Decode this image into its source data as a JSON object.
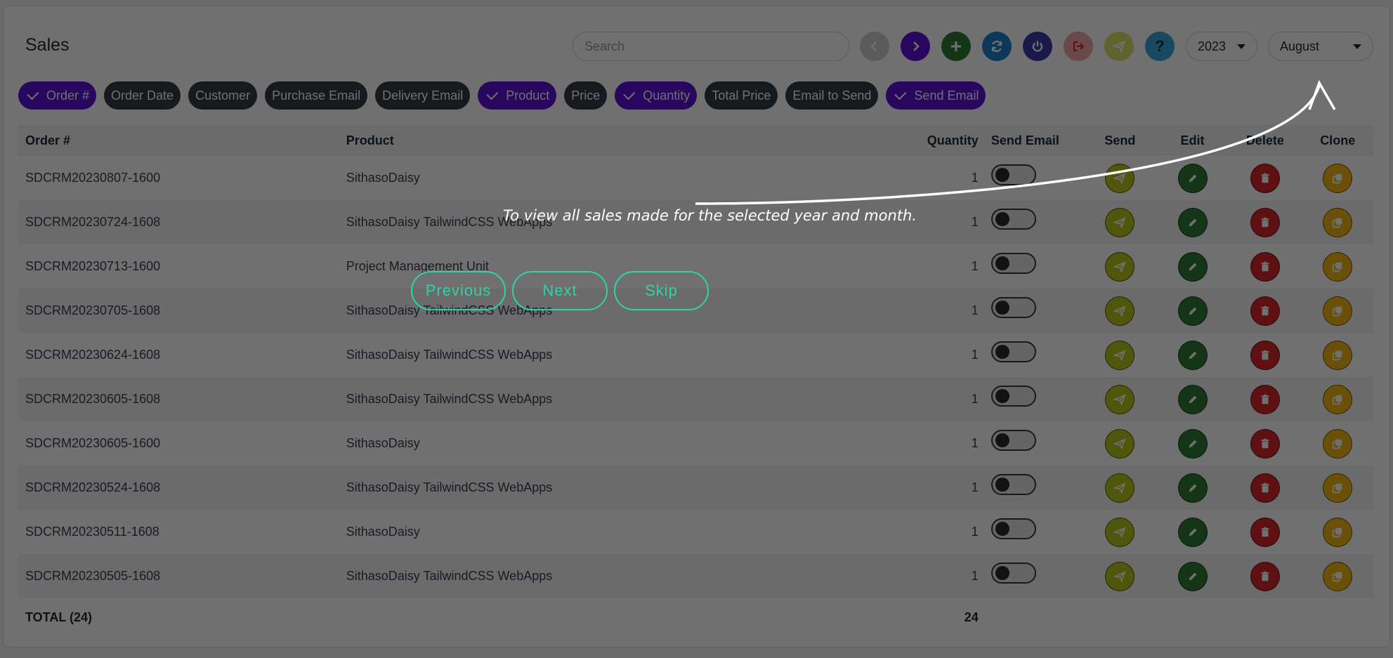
{
  "page": {
    "title": "Sales"
  },
  "search": {
    "placeholder": "Search"
  },
  "toolbar": {
    "year": "2023",
    "month": "August",
    "buttons": [
      {
        "name": "prev-button",
        "icon": "chevron-left-icon",
        "color": "#cfcfcf"
      },
      {
        "name": "next-button",
        "icon": "chevron-right-icon",
        "color": "#5b14d6"
      },
      {
        "name": "add-button",
        "icon": "plus-icon",
        "color": "#2f7a32"
      },
      {
        "name": "refresh-button",
        "icon": "refresh-icon",
        "color": "#1f7fd1"
      },
      {
        "name": "power-button",
        "icon": "power-icon",
        "color": "#3d3ca8"
      },
      {
        "name": "export-button",
        "icon": "export-icon",
        "color": "#f4a7a7"
      },
      {
        "name": "send-button",
        "icon": "paper-plane-icon",
        "color": "#d9e26a"
      },
      {
        "name": "help-button",
        "icon": "question-icon",
        "color": "#3aa7d9"
      }
    ]
  },
  "chips": [
    {
      "label": "Order #",
      "active": true
    },
    {
      "label": "Order Date",
      "active": false
    },
    {
      "label": "Customer",
      "active": false
    },
    {
      "label": "Purchase Email",
      "active": false
    },
    {
      "label": "Delivery Email",
      "active": false
    },
    {
      "label": "Product",
      "active": true
    },
    {
      "label": "Price",
      "active": false
    },
    {
      "label": "Quantity",
      "active": true
    },
    {
      "label": "Total Price",
      "active": false
    },
    {
      "label": "Email to Send",
      "active": false
    },
    {
      "label": "Send Email",
      "active": true
    }
  ],
  "table": {
    "headers": {
      "order": "Order #",
      "product": "Product",
      "quantity": "Quantity",
      "send_email": "Send Email",
      "send": "Send",
      "edit": "Edit",
      "delete": "Delete",
      "clone": "Clone"
    },
    "rows": [
      {
        "order": "SDCRM20230807-1600",
        "product": "SithasoDaisy",
        "quantity": "1"
      },
      {
        "order": "SDCRM20230724-1608",
        "product": "SithasoDaisy TailwindCSS WebApps",
        "quantity": "1"
      },
      {
        "order": "SDCRM20230713-1600",
        "product": "Project Management Unit",
        "quantity": "1"
      },
      {
        "order": "SDCRM20230705-1608",
        "product": "SithasoDaisy TailwindCSS WebApps",
        "quantity": "1"
      },
      {
        "order": "SDCRM20230624-1608",
        "product": "SithasoDaisy TailwindCSS WebApps",
        "quantity": "1"
      },
      {
        "order": "SDCRM20230605-1608",
        "product": "SithasoDaisy TailwindCSS WebApps",
        "quantity": "1"
      },
      {
        "order": "SDCRM20230605-1600",
        "product": "SithasoDaisy",
        "quantity": "1"
      },
      {
        "order": "SDCRM20230524-1608",
        "product": "SithasoDaisy TailwindCSS WebApps",
        "quantity": "1"
      },
      {
        "order": "SDCRM20230511-1608",
        "product": "SithasoDaisy",
        "quantity": "1"
      },
      {
        "order": "SDCRM20230505-1608",
        "product": "SithasoDaisy TailwindCSS WebApps",
        "quantity": "1"
      }
    ],
    "footer": {
      "label": "TOTAL (24)",
      "quantity": "24"
    }
  },
  "tour": {
    "text": "To view all sales made for the selected year and month.",
    "previous": "Previous",
    "next": "Next",
    "skip": "Skip"
  }
}
